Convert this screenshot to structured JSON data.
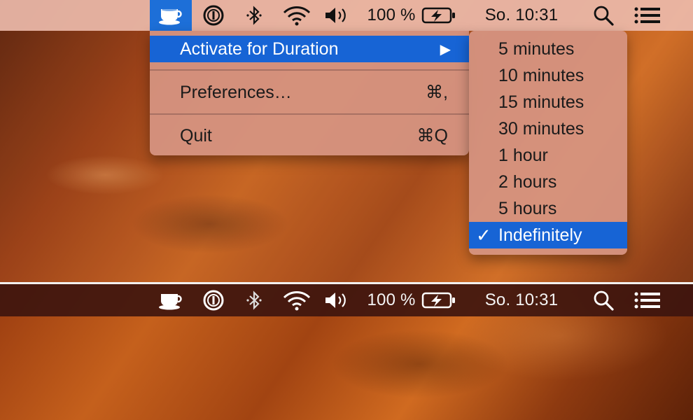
{
  "menubar": {
    "battery_percent": "100 %",
    "clock": "So. 10:31",
    "icons": [
      "coffee-cup-icon",
      "password-manager-icon",
      "bluetooth-icon",
      "wifi-icon",
      "volume-icon",
      "battery-charging-icon",
      "spotlight-search-icon",
      "notification-center-icon"
    ]
  },
  "menu": {
    "activate_label": "Activate for Duration",
    "activate_arrow": "▶",
    "preferences_label": "Preferences…",
    "preferences_shortcut": "⌘,",
    "quit_label": "Quit",
    "quit_shortcut": "⌘Q"
  },
  "submenu": {
    "items": [
      "5 minutes",
      "10 minutes",
      "15 minutes",
      "30 minutes",
      "1 hour",
      "2 hours",
      "5 hours",
      "Indefinitely"
    ],
    "selected": "Indefinitely",
    "check_mark": "✓"
  },
  "colors": {
    "highlight": "#1764d5",
    "menu_background": "#d69482",
    "menubar_light": "#ecbaaa",
    "menubar_dark": "#3c140e"
  }
}
